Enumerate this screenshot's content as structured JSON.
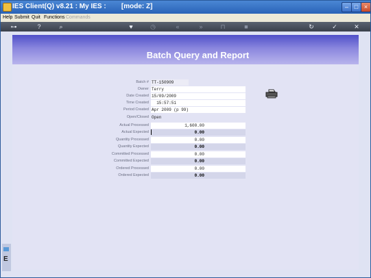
{
  "window": {
    "title": "IES Client(Q) v8.21 : My IES :        [mode: Z]"
  },
  "menu": {
    "items": [
      "Help",
      "Submit",
      "Quit",
      "Functions"
    ],
    "disabled_item": "Commands"
  },
  "toolbar": {
    "key_icon": "⊶",
    "help_icon": "?",
    "search_icon": "⌕",
    "heart_icon": "♥",
    "clock_icon": "◷",
    "back_icon": "«",
    "forward_icon": "»",
    "lock_icon": "⊓",
    "stop_icon": "■",
    "refresh_icon": "↻",
    "ok_icon": "✓",
    "cancel_icon": "✕"
  },
  "page": {
    "title": "Batch Query and Report"
  },
  "fields": [
    {
      "label": "Batch #",
      "value": "TT-150909"
    },
    {
      "label": "Owner",
      "value": "Terry"
    },
    {
      "label": "Date Created",
      "value": "15/09/2009"
    },
    {
      "label": "Time Created",
      "value": "  15:57:51"
    },
    {
      "label": "Period Created",
      "value": "Apr 2009 (p 99)"
    },
    {
      "label": "Open/Closed",
      "value": "Open"
    },
    {
      "label": "Actual Processed",
      "value": "1,600.00"
    },
    {
      "label": "Actual Expected",
      "value": "0.00"
    },
    {
      "label": "Quantity Processed",
      "value": "0.00"
    },
    {
      "label": "Quantity Expected",
      "value": "0.00"
    },
    {
      "label": "Committed Processed",
      "value": "0.00"
    },
    {
      "label": "Committed Expected",
      "value": "0.00"
    },
    {
      "label": "Ordered Processed",
      "value": "0.00"
    },
    {
      "label": "Ordered Expected",
      "value": "0.00"
    }
  ],
  "printer_icon": "printer-icon",
  "side_letter": "E"
}
